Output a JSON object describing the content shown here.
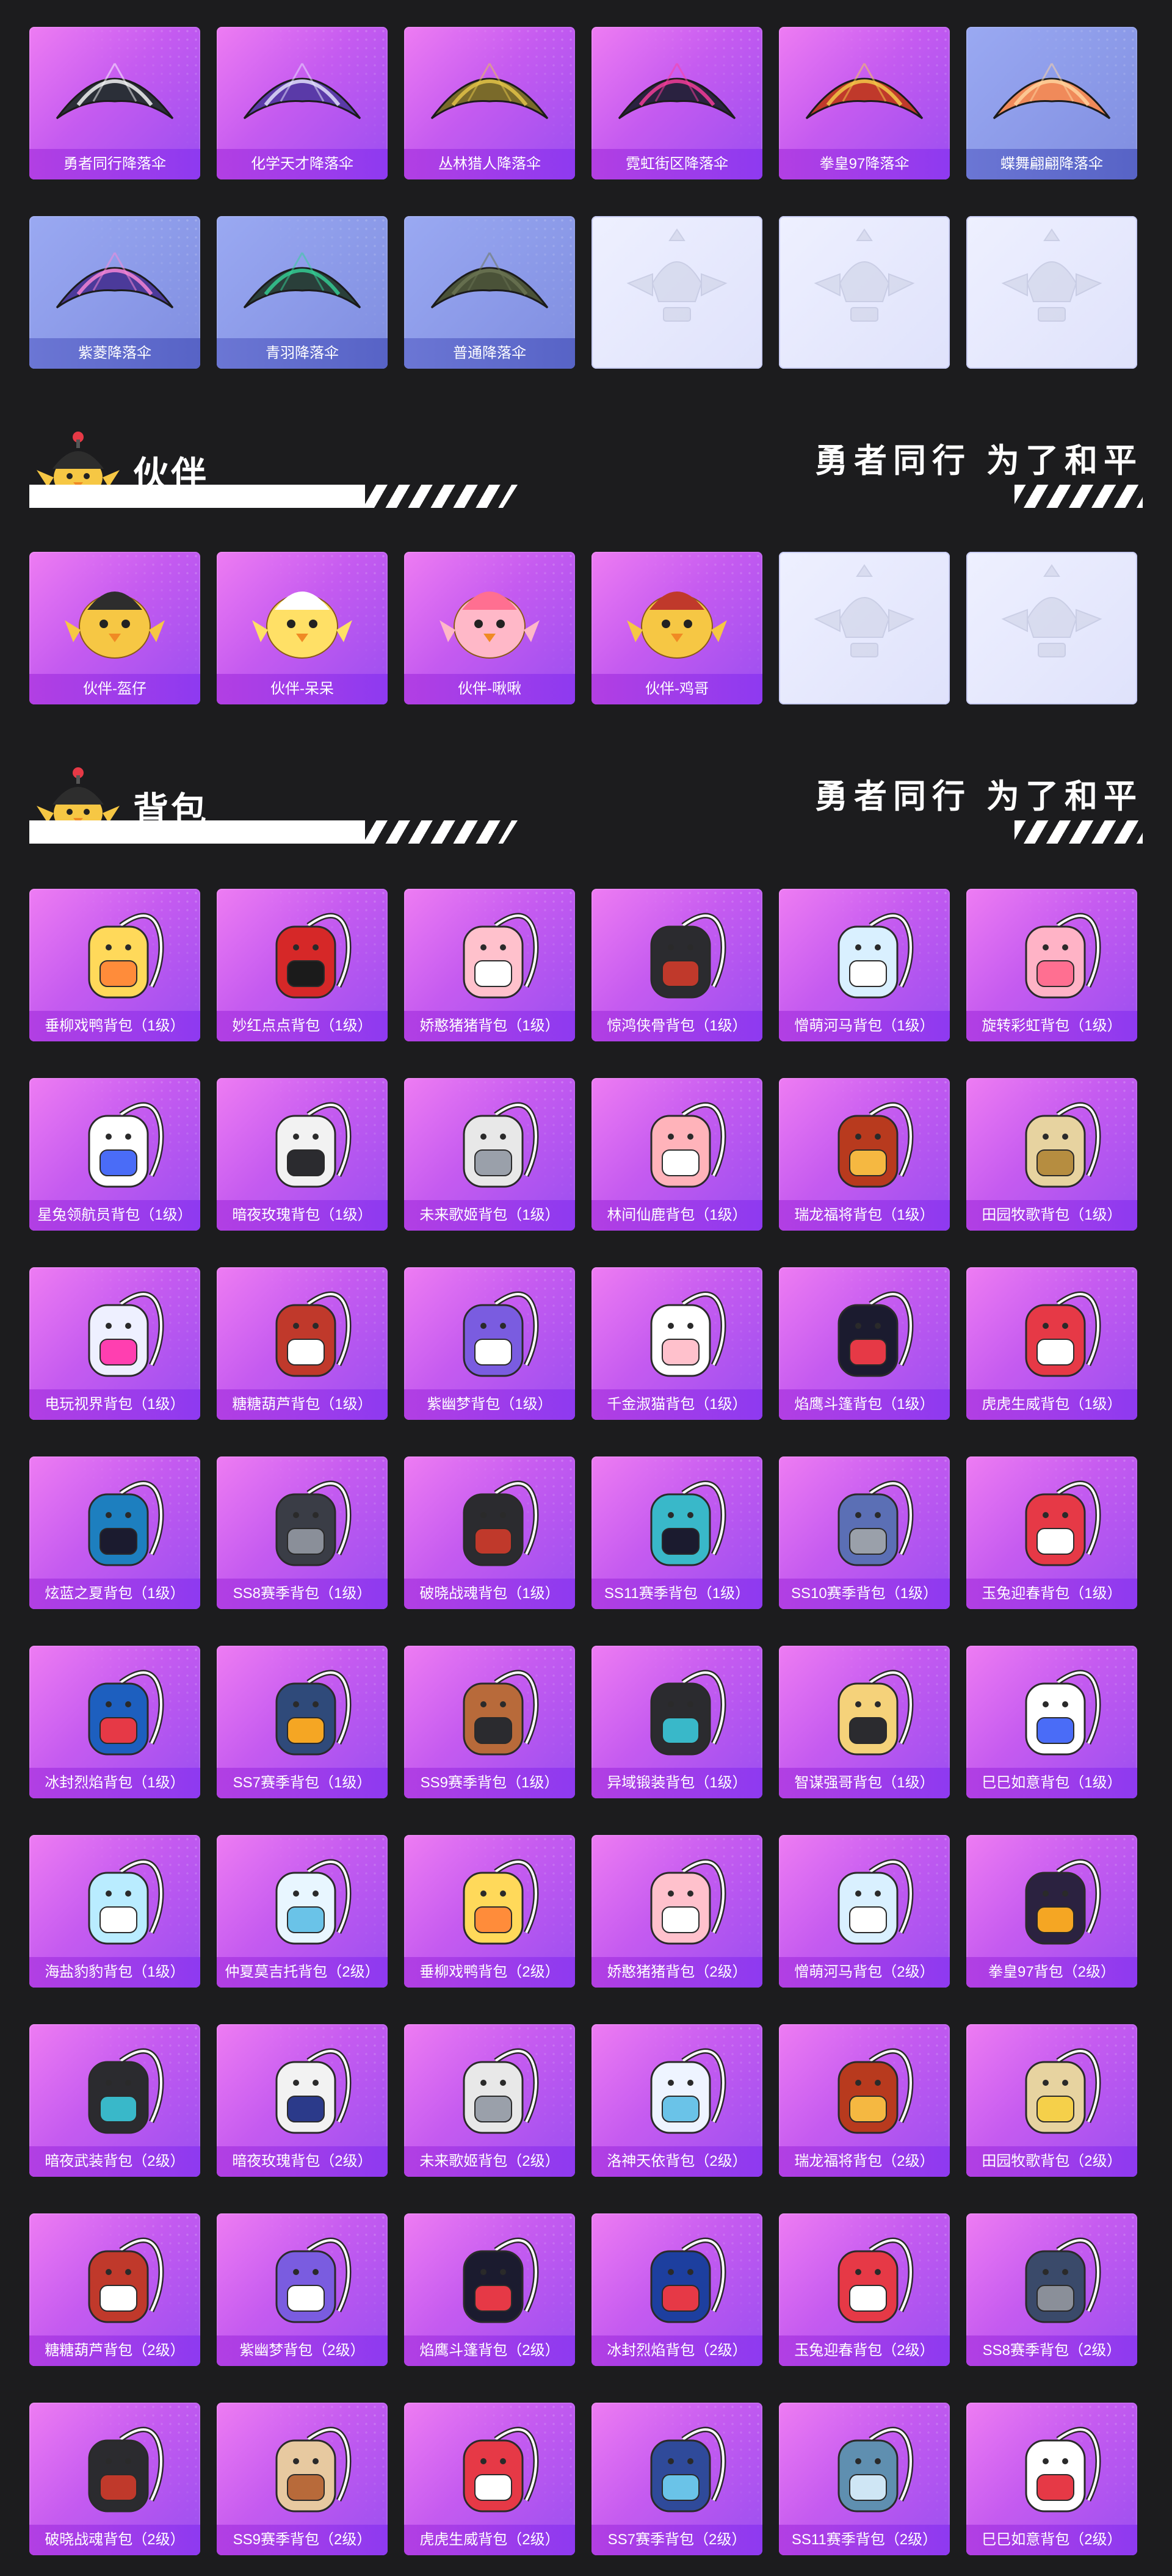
{
  "parachutes": [
    {
      "label": "勇者同行降落伞",
      "style": "pink",
      "art": "parachute",
      "color": "#2b2f38",
      "accent": "#ffffff"
    },
    {
      "label": "化学天才降落伞",
      "style": "pink",
      "art": "parachute",
      "color": "#5a3aa8",
      "accent": "#e8e8ff"
    },
    {
      "label": "丛林猎人降落伞",
      "style": "pink",
      "art": "parachute",
      "color": "#7a6a2a",
      "accent": "#e8c84a"
    },
    {
      "label": "霓虹街区降落伞",
      "style": "pink",
      "art": "parachute",
      "color": "#2a2240",
      "accent": "#ff3f9e"
    },
    {
      "label": "拳皇97降落伞",
      "style": "pink",
      "art": "parachute",
      "color": "#c0392b",
      "accent": "#f5d04a"
    },
    {
      "label": "蝶舞翩翩降落伞",
      "style": "blue",
      "art": "parachute",
      "color": "#f08a5a",
      "accent": "#ffd6a0"
    },
    {
      "label": "紫菱降落伞",
      "style": "blue",
      "art": "parachute",
      "color": "#4b3a9a",
      "accent": "#ff8ad8"
    },
    {
      "label": "青羽降落伞",
      "style": "blue",
      "art": "parachute",
      "color": "#2a3f3a",
      "accent": "#34d399"
    },
    {
      "label": "普通降落伞",
      "style": "blue",
      "art": "parachute",
      "color": "#4a5238",
      "accent": "#6b7554"
    },
    {
      "label": "",
      "style": "empty",
      "art": "emblem",
      "color": "#cfd3e6",
      "accent": "#eef0ff"
    },
    {
      "label": "",
      "style": "empty",
      "art": "emblem",
      "color": "#cfd3e6",
      "accent": "#eef0ff"
    },
    {
      "label": "",
      "style": "empty",
      "art": "emblem",
      "color": "#cfd3e6",
      "accent": "#eef0ff"
    }
  ],
  "partners_section": {
    "title": "伙伴",
    "slogan": "勇者同行 为了和平"
  },
  "partners": [
    {
      "label": "伙伴-盔仔",
      "style": "pink",
      "art": "chick",
      "color": "#f6c744",
      "accent": "#2d2d2d"
    },
    {
      "label": "伙伴-呆呆",
      "style": "pink",
      "art": "chick",
      "color": "#ffe066",
      "accent": "#ffffff"
    },
    {
      "label": "伙伴-啾啾",
      "style": "pink",
      "art": "chick",
      "color": "#ffb8c8",
      "accent": "#ff6f91"
    },
    {
      "label": "伙伴-鸡哥",
      "style": "pink",
      "art": "chick",
      "color": "#f6c744",
      "accent": "#c0392b"
    },
    {
      "label": "",
      "style": "empty",
      "art": "emblem",
      "color": "#cfd3e6",
      "accent": "#eef0ff"
    },
    {
      "label": "",
      "style": "empty",
      "art": "emblem",
      "color": "#cfd3e6",
      "accent": "#eef0ff"
    }
  ],
  "backpacks_section": {
    "title": "背包",
    "slogan": "勇者同行 为了和平"
  },
  "backpacks": [
    {
      "label": "垂柳戏鸭背包（1级）",
      "style": "pink",
      "art": "backpack",
      "color": "#ffd95a",
      "accent": "#ff8c3a"
    },
    {
      "label": "妙红点点背包（1级）",
      "style": "pink",
      "art": "backpack",
      "color": "#d62828",
      "accent": "#1b1b1b"
    },
    {
      "label": "娇憨猪猪背包（1级）",
      "style": "pink",
      "art": "backpack",
      "color": "#ffc1cc",
      "accent": "#ffffff"
    },
    {
      "label": "惊鸿侠骨背包（1级）",
      "style": "pink",
      "art": "backpack",
      "color": "#2b2b2f",
      "accent": "#c0392b"
    },
    {
      "label": "憎萌河马背包（1级）",
      "style": "pink",
      "art": "backpack",
      "color": "#d9f0ff",
      "accent": "#ffffff"
    },
    {
      "label": "旋转彩虹背包（1级）",
      "style": "pink",
      "art": "backpack",
      "color": "#ffb3c6",
      "accent": "#ff6f91"
    },
    {
      "label": "星兔领航员背包（1级）",
      "style": "pink",
      "art": "backpack",
      "color": "#ffffff",
      "accent": "#4a6cf7"
    },
    {
      "label": "暗夜玫瑰背包（1级）",
      "style": "pink",
      "art": "backpack",
      "color": "#f2f2f2",
      "accent": "#2b2b2f"
    },
    {
      "label": "未来歌姬背包（1级）",
      "style": "pink",
      "art": "backpack",
      "color": "#e8e8e8",
      "accent": "#9aa0aa"
    },
    {
      "label": "林间仙鹿背包（1级）",
      "style": "pink",
      "art": "backpack",
      "color": "#ffb3ba",
      "accent": "#ffffff"
    },
    {
      "label": "瑞龙福将背包（1级）",
      "style": "pink",
      "art": "backpack",
      "color": "#b83a1e",
      "accent": "#f5b841"
    },
    {
      "label": "田园牧歌背包（1级）",
      "style": "pink",
      "art": "backpack",
      "color": "#e7d3a0",
      "accent": "#b68d40"
    },
    {
      "label": "电玩视界背包（1级）",
      "style": "pink",
      "art": "backpack",
      "color": "#eef0ff",
      "accent": "#ff3fb0"
    },
    {
      "label": "糖糖葫芦背包（1级）",
      "style": "pink",
      "art": "backpack",
      "color": "#c0392b",
      "accent": "#ffffff"
    },
    {
      "label": "紫幽梦背包（1级）",
      "style": "pink",
      "art": "backpack",
      "color": "#7a5ce0",
      "accent": "#ffffff"
    },
    {
      "label": "千金淑猫背包（1级）",
      "style": "pink",
      "art": "backpack",
      "color": "#ffffff",
      "accent": "#ffc1cc"
    },
    {
      "label": "焰鹰斗篷背包（1级）",
      "style": "pink",
      "art": "backpack",
      "color": "#1b1b2f",
      "accent": "#e63946"
    },
    {
      "label": "虎虎生威背包（1级）",
      "style": "pink",
      "art": "backpack",
      "color": "#e63946",
      "accent": "#ffffff"
    },
    {
      "label": "炫蓝之夏背包（1级）",
      "style": "pink",
      "art": "backpack",
      "color": "#1d7fbf",
      "accent": "#1b1b2f"
    },
    {
      "label": "SS8赛季背包（1级）",
      "style": "pink",
      "art": "backpack",
      "color": "#3a3d46",
      "accent": "#8a8f99"
    },
    {
      "label": "破晓战魂背包（1级）",
      "style": "pink",
      "art": "backpack",
      "color": "#2b2b2f",
      "accent": "#c0392b"
    },
    {
      "label": "SS11赛季背包（1级）",
      "style": "pink",
      "art": "backpack",
      "color": "#39b8c9",
      "accent": "#1b1b2f"
    },
    {
      "label": "SS10赛季背包（1级）",
      "style": "pink",
      "art": "backpack",
      "color": "#5b6fb5",
      "accent": "#9aa0aa"
    },
    {
      "label": "玉兔迎春背包（1级）",
      "style": "pink",
      "art": "backpack",
      "color": "#e63946",
      "accent": "#ffffff"
    },
    {
      "label": "冰封烈焰背包（1级）",
      "style": "pink",
      "art": "backpack",
      "color": "#1d5fbf",
      "accent": "#e63946"
    },
    {
      "label": "SS7赛季背包（1级）",
      "style": "pink",
      "art": "backpack",
      "color": "#2f4a7a",
      "accent": "#f5a623"
    },
    {
      "label": "SS9赛季背包（1级）",
      "style": "pink",
      "art": "backpack",
      "color": "#b86a3a",
      "accent": "#2b2b2f"
    },
    {
      "label": "异域锻装背包（1级）",
      "style": "pink",
      "art": "backpack",
      "color": "#2b2b2f",
      "accent": "#39b8c9"
    },
    {
      "label": "智谋强哥背包（1级）",
      "style": "pink",
      "art": "backpack",
      "color": "#f5d27a",
      "accent": "#2b2b2f"
    },
    {
      "label": "巳巳如意背包（1级）",
      "style": "pink",
      "art": "backpack",
      "color": "#ffffff",
      "accent": "#4a6cf7"
    },
    {
      "label": "海盐豹豹背包（1级）",
      "style": "pink",
      "art": "backpack",
      "color": "#b9ecff",
      "accent": "#ffffff"
    },
    {
      "label": "仲夏莫吉托背包（2级）",
      "style": "pink",
      "art": "backpack",
      "color": "#e8f6ff",
      "accent": "#6ac3e8"
    },
    {
      "label": "垂柳戏鸭背包（2级）",
      "style": "pink",
      "art": "backpack",
      "color": "#ffd95a",
      "accent": "#ff8c3a"
    },
    {
      "label": "娇憨猪猪背包（2级）",
      "style": "pink",
      "art": "backpack",
      "color": "#ffc1cc",
      "accent": "#ffffff"
    },
    {
      "label": "憎萌河马背包（2级）",
      "style": "pink",
      "art": "backpack",
      "color": "#d9f0ff",
      "accent": "#ffffff"
    },
    {
      "label": "拳皇97背包（2级）",
      "style": "pink",
      "art": "backpack",
      "color": "#2b2240",
      "accent": "#f5a623"
    },
    {
      "label": "暗夜武装背包（2级）",
      "style": "pink",
      "art": "backpack",
      "color": "#2b2b2f",
      "accent": "#39b8c9"
    },
    {
      "label": "暗夜玫瑰背包（2级）",
      "style": "pink",
      "art": "backpack",
      "color": "#f2f2f2",
      "accent": "#2b3a8a"
    },
    {
      "label": "未来歌姬背包（2级）",
      "style": "pink",
      "art": "backpack",
      "color": "#e8e8e8",
      "accent": "#9aa0aa"
    },
    {
      "label": "洛神天依背包（2级）",
      "style": "pink",
      "art": "backpack",
      "color": "#eef4ff",
      "accent": "#6ac3e8"
    },
    {
      "label": "瑞龙福将背包（2级）",
      "style": "pink",
      "art": "backpack",
      "color": "#b83a1e",
      "accent": "#f5b841"
    },
    {
      "label": "田园牧歌背包（2级）",
      "style": "pink",
      "art": "backpack",
      "color": "#e7d3a0",
      "accent": "#f5d04a"
    },
    {
      "label": "糖糖葫芦背包（2级）",
      "style": "pink",
      "art": "backpack",
      "color": "#c0392b",
      "accent": "#ffffff"
    },
    {
      "label": "紫幽梦背包（2级）",
      "style": "pink",
      "art": "backpack",
      "color": "#7a5ce0",
      "accent": "#ffffff"
    },
    {
      "label": "焰鹰斗篷背包（2级）",
      "style": "pink",
      "art": "backpack",
      "color": "#1b1b2f",
      "accent": "#e63946"
    },
    {
      "label": "冰封烈焰背包（2级）",
      "style": "pink",
      "art": "backpack",
      "color": "#1d3f9f",
      "accent": "#e63946"
    },
    {
      "label": "玉兔迎春背包（2级）",
      "style": "pink",
      "art": "backpack",
      "color": "#e63946",
      "accent": "#ffffff"
    },
    {
      "label": "SS8赛季背包（2级）",
      "style": "pink",
      "art": "backpack",
      "color": "#3a4a6a",
      "accent": "#8a8f99"
    },
    {
      "label": "破晓战魂背包（2级）",
      "style": "pink",
      "art": "backpack",
      "color": "#2b2b2f",
      "accent": "#c0392b"
    },
    {
      "label": "SS9赛季背包（2级）",
      "style": "pink",
      "art": "backpack",
      "color": "#e7c9a0",
      "accent": "#b86a3a"
    },
    {
      "label": "虎虎生威背包（2级）",
      "style": "pink",
      "art": "backpack",
      "color": "#e63946",
      "accent": "#ffffff"
    },
    {
      "label": "SS7赛季背包（2级）",
      "style": "pink",
      "art": "backpack",
      "color": "#2f4a9a",
      "accent": "#6ac3e8"
    },
    {
      "label": "SS11赛季背包（2级）",
      "style": "pink",
      "art": "backpack",
      "color": "#5f8fb0",
      "accent": "#cfe6f5"
    },
    {
      "label": "巳巳如意背包（2级）",
      "style": "pink",
      "art": "backpack",
      "color": "#ffffff",
      "accent": "#e63946"
    }
  ]
}
